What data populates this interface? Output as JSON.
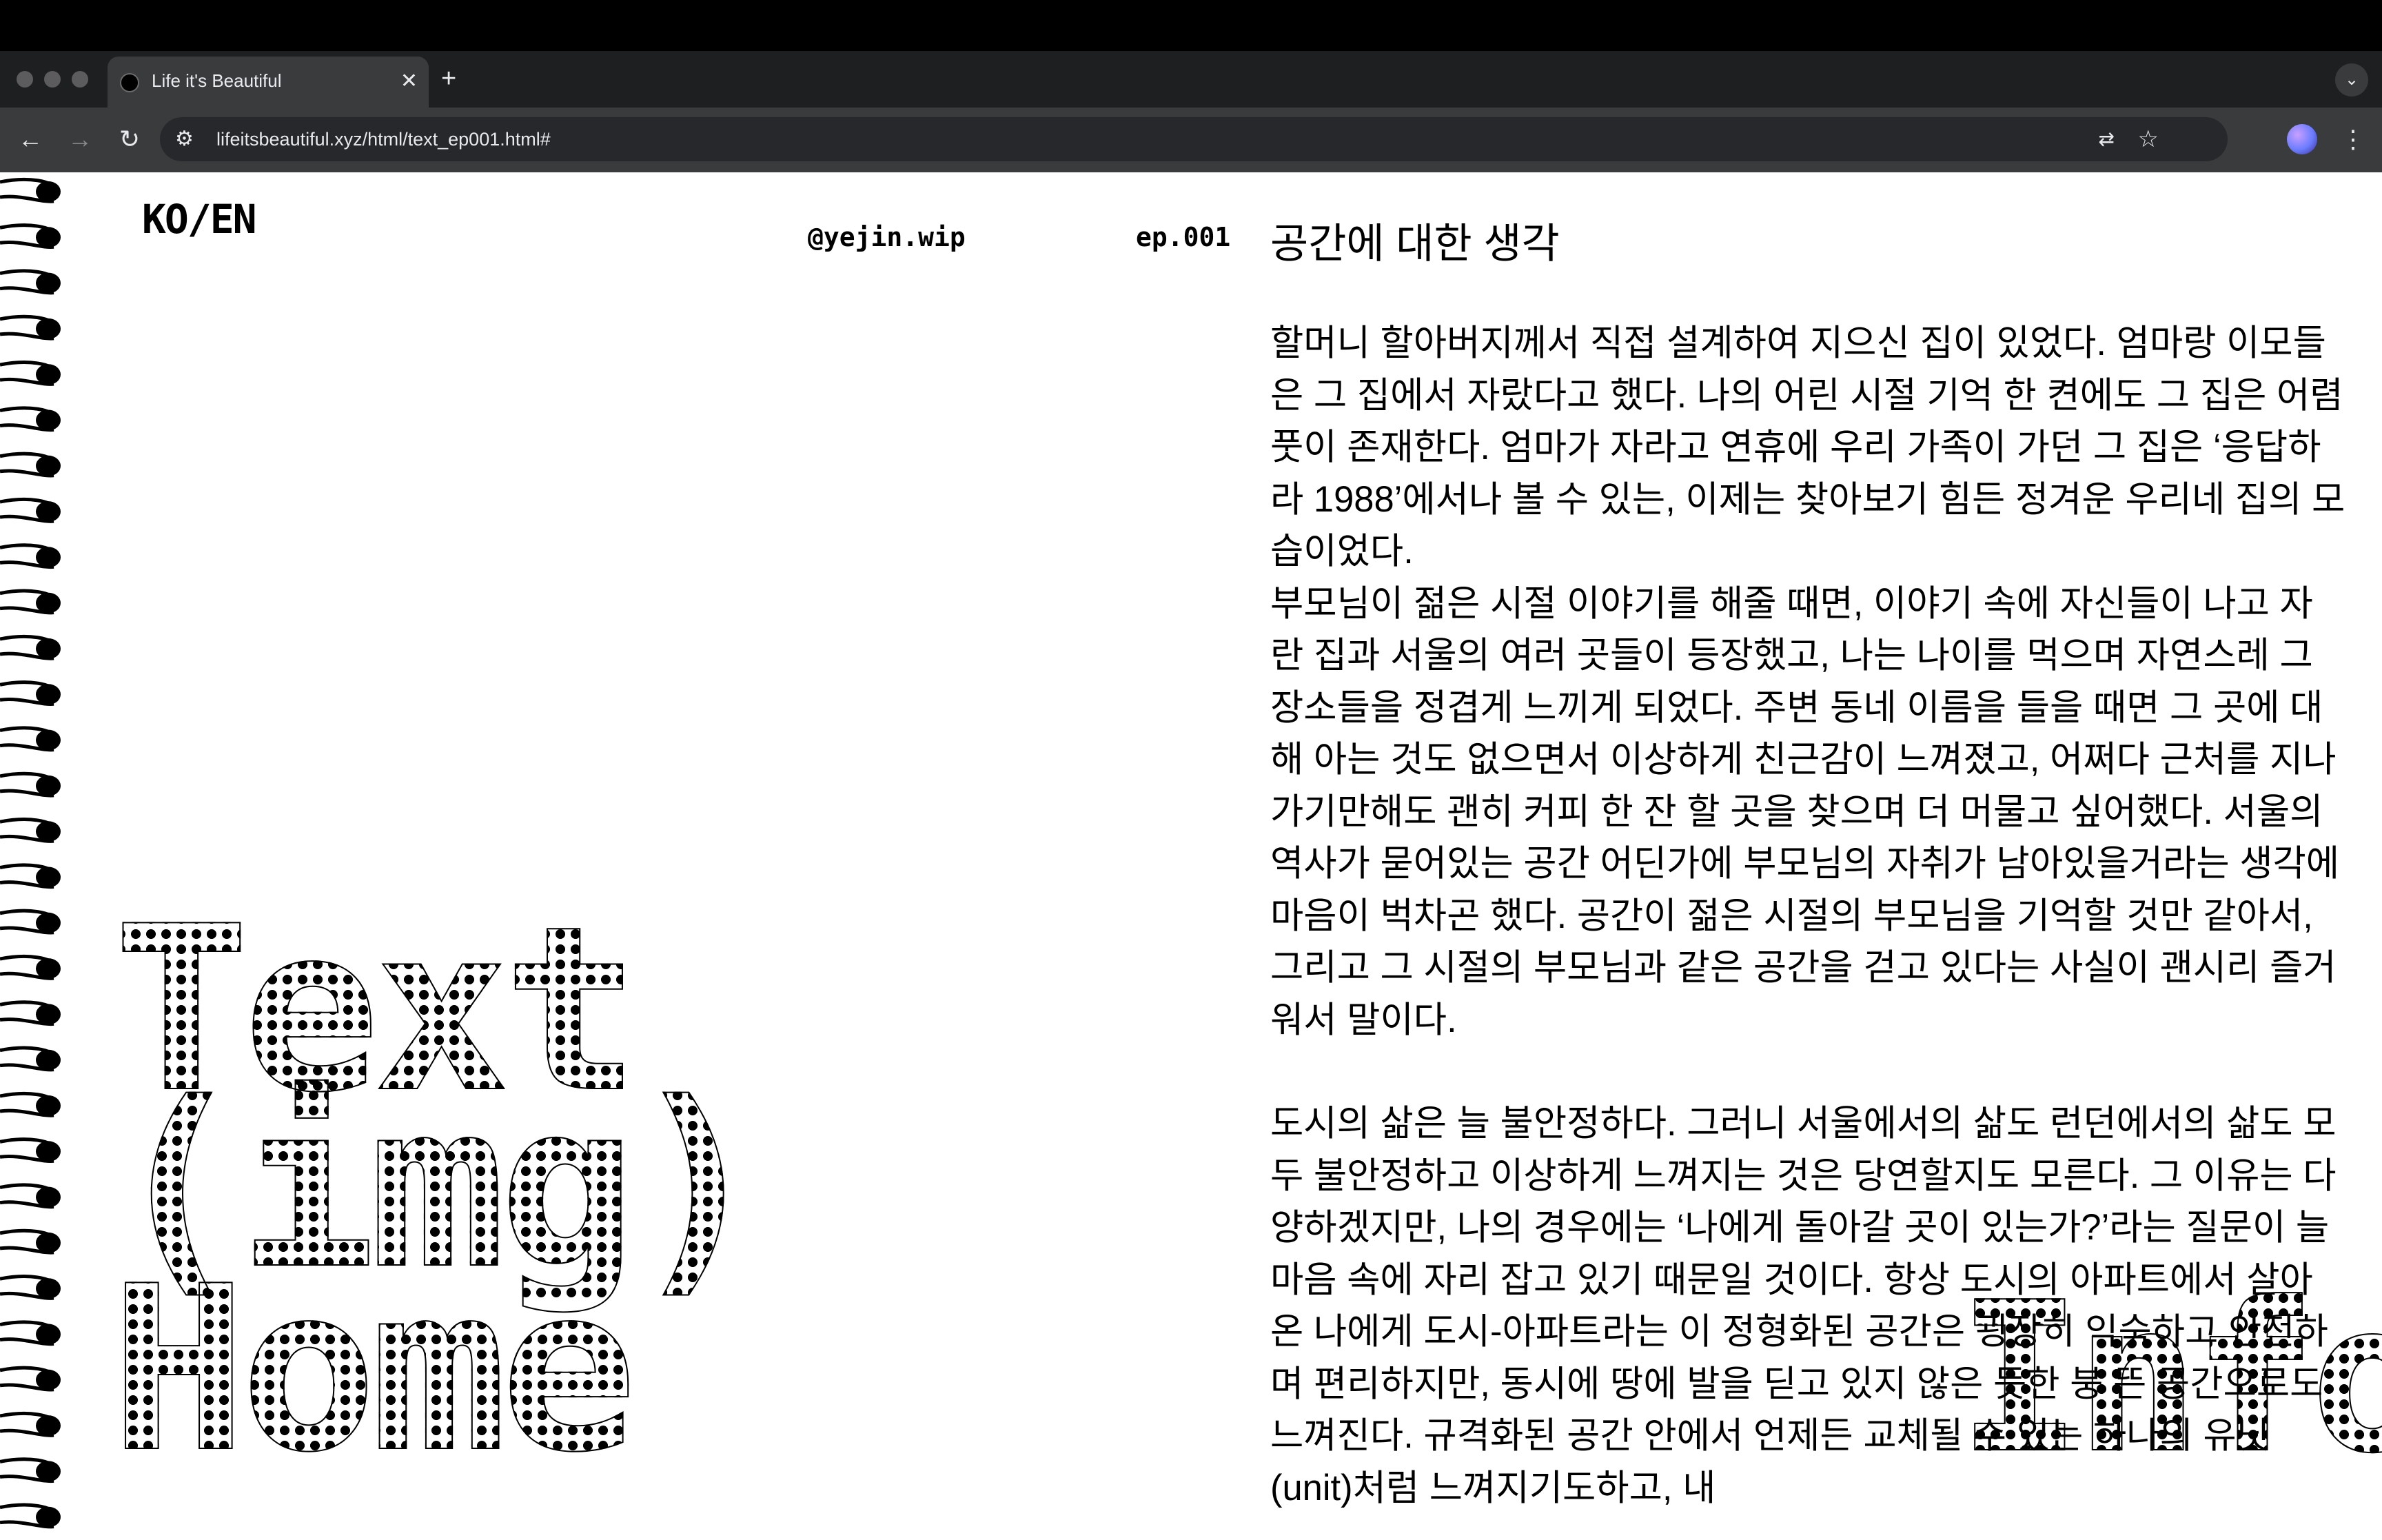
{
  "browser": {
    "tab_title": "Life it's Beautiful",
    "tab_close": "✕",
    "new_tab": "+",
    "tab_menu": "⌄",
    "back": "←",
    "forward": "→",
    "reload": "↻",
    "site_info": "⚙",
    "url": "lifeitsbeautiful.xyz/html/text_ep001.html#",
    "translate": "⇄",
    "bookmark": "☆",
    "menu": "⋮"
  },
  "header": {
    "lang_toggle": "KO/EN",
    "handle": "@yejin.wip",
    "episode": "ep.001"
  },
  "article": {
    "title": "공간에 대한 생각",
    "paragraphs": [
      "할머니 할아버지께서 직접 설계하여 지으신 집이 있었다. 엄마랑 이모들은 그 집에서 자랐다고 했다. 나의 어린 시절 기억 한 켠에도 그 집은 어렴풋이 존재한다. 엄마가 자라고 연휴에 우리 가족이 가던 그 집은 ‘응답하라 1988’에서나 볼 수 있는, 이제는 찾아보기 힘든 정겨운 우리네 집의 모습이었다.",
      "부모님이 젊은 시절 이야기를 해줄 때면, 이야기 속에 자신들이 나고 자란 집과 서울의 여러 곳들이 등장했고, 나는 나이를 먹으며 자연스레 그 장소들을 정겹게 느끼게 되었다. 주변 동네 이름을 들을 때면 그 곳에 대해 아는 것도 없으면서 이상하게 친근감이 느껴졌고, 어쩌다 근처를 지나가기만해도 괜히 커피 한 잔 할 곳을 찾으며 더 머물고 싶어했다. 서울의 역사가 묻어있는 공간 어딘가에 부모님의 자취가 남아있을거라는 생각에 마음이 벅차곤 했다. 공간이 젊은 시절의 부모님을 기억할 것만 같아서, 그리고 그 시절의 부모님과 같은 공간을 걷고 있다는 사실이 괜시리 즐거워서 말이다.",
      "도시의 삶은 늘 불안정하다. 그러니 서울에서의 삶도 런던에서의 삶도 모두 불안정하고 이상하게 느껴지는 것은 당연할지도 모른다. 그 이유는 다양하겠지만, 나의 경우에는 ‘나에게 돌아갈 곳이 있는가?’라는 질문이 늘 마음 속에 자리 잡고 있기 때문일 것이다. 항상 도시의 아파트에서 살아온 나에게 도시-아파트라는 이 정형화된 공간은 굉장히 익숙하고 안전하며 편리하지만, 동시에 땅에 발을 딛고 있지 않은 듯한 붕 뜬 공간으로도 느껴진다. 규격화된 공간 안에서 언제든 교체될 수 있는 하나의 유닛(unit)처럼 느껴지기도하고, 내"
    ]
  },
  "nav": {
    "text": "Text",
    "img": "(img)",
    "home": "Home",
    "info": "Info"
  }
}
